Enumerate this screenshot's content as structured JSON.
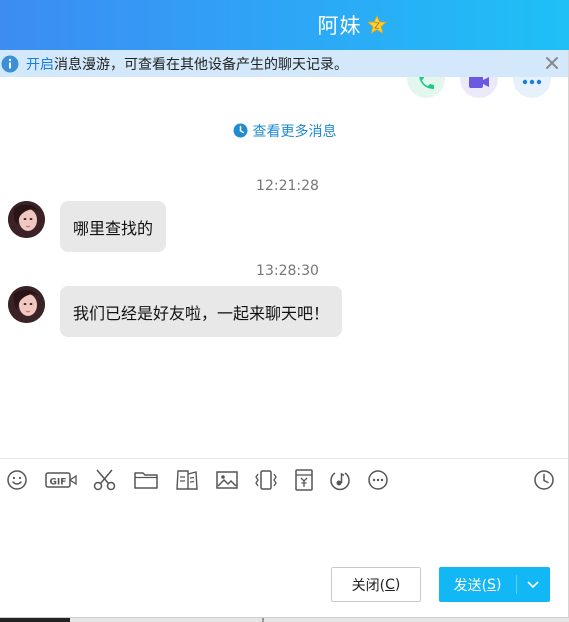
{
  "window": {
    "title": "阿妹",
    "vip_badge_icon": "vip-star-icon"
  },
  "notice": {
    "link_text": "开启",
    "text": "消息漫游，可查看在其他设备产生的聊天记录。",
    "close_icon": "close-icon"
  },
  "call_buttons": [
    "phone-call",
    "video-call",
    "more-options"
  ],
  "history": {
    "more_label": "查看更多消息"
  },
  "messages": [
    {
      "time": "12:21:28",
      "text": "哪里查找的"
    },
    {
      "time": "13:28:30",
      "text": "我们已经是好友啦，一起来聊天吧！"
    }
  ],
  "toolbar": {
    "items": [
      "emoji-icon",
      "gif-icon",
      "screenshot-scissors-icon",
      "folder-icon",
      "document-icon",
      "image-icon",
      "shake-icon",
      "red-packet-icon",
      "music-icon",
      "more-icon",
      "history-clock-icon"
    ],
    "gif_label": "GIF"
  },
  "actions": {
    "close_label": "关闭(",
    "close_hotkey": "C",
    "close_suffix": ")",
    "send_label": "发送(",
    "send_hotkey": "S",
    "send_suffix": ")"
  },
  "colors": {
    "titlebar_start": "#3d8cf2",
    "titlebar_end": "#1fc0f6",
    "notice_bg": "#d3e9fb",
    "link": "#1a7ee0",
    "send_button": "#12b7f5",
    "bubble_bg": "#e8e8e8"
  }
}
